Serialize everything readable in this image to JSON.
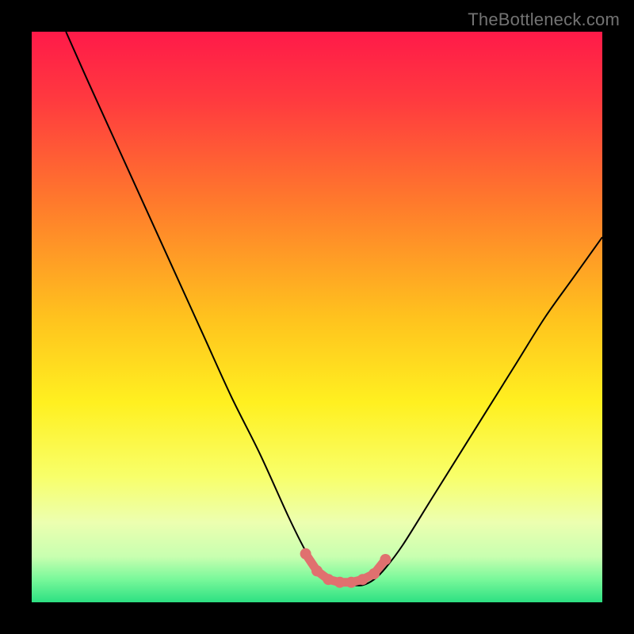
{
  "watermark": {
    "text": "TheBottleneck.com"
  },
  "colors": {
    "frame": "#000000",
    "curve": "#000000",
    "marker": "#e0706f",
    "gradient_stops": [
      {
        "offset": 0.0,
        "color": "#ff1a49"
      },
      {
        "offset": 0.12,
        "color": "#ff3a3f"
      },
      {
        "offset": 0.3,
        "color": "#ff7a2c"
      },
      {
        "offset": 0.5,
        "color": "#ffc21e"
      },
      {
        "offset": 0.65,
        "color": "#fff020"
      },
      {
        "offset": 0.78,
        "color": "#f8ff6a"
      },
      {
        "offset": 0.86,
        "color": "#ecffb0"
      },
      {
        "offset": 0.92,
        "color": "#c8ffb0"
      },
      {
        "offset": 0.96,
        "color": "#78f89a"
      },
      {
        "offset": 1.0,
        "color": "#2de082"
      }
    ]
  },
  "chart_data": {
    "type": "line",
    "title": "",
    "xlabel": "",
    "ylabel": "",
    "xlim": [
      0,
      100
    ],
    "ylim": [
      0,
      100
    ],
    "grid": false,
    "legend": false,
    "series": [
      {
        "name": "bottleneck-curve",
        "x": [
          6,
          10,
          15,
          20,
          25,
          30,
          35,
          40,
          45,
          48,
          50,
          52,
          54,
          56,
          58,
          60,
          62,
          65,
          70,
          75,
          80,
          85,
          90,
          95,
          100
        ],
        "values": [
          100,
          91,
          80,
          69,
          58,
          47,
          36,
          26,
          15,
          9,
          6,
          4,
          3,
          3,
          3,
          4,
          6,
          10,
          18,
          26,
          34,
          42,
          50,
          57,
          64
        ]
      }
    ],
    "markers": {
      "name": "bottom-cluster",
      "color": "#e0706f",
      "x": [
        48,
        50,
        52,
        54,
        56,
        58,
        60,
        62
      ],
      "values": [
        8.5,
        5.5,
        4,
        3.5,
        3.5,
        4,
        5,
        7.5
      ]
    }
  }
}
